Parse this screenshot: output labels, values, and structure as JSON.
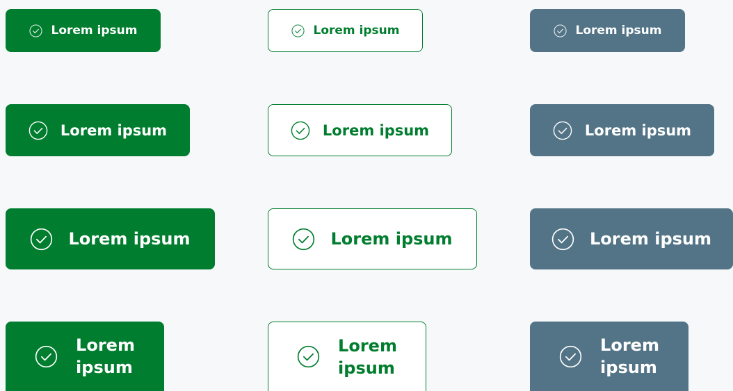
{
  "buttons": {
    "label": "Lorem ipsum",
    "wrapped_line1": "Lorem",
    "wrapped_line2": "ipsum",
    "icon": "check-circle-icon"
  },
  "variants": [
    "primary",
    "outline",
    "secondary"
  ],
  "sizes": [
    "small",
    "medium",
    "large",
    "wrapped"
  ],
  "colors": {
    "primary": "#007d2e",
    "secondary": "#537486",
    "outline_border": "#007d2e",
    "outline_text": "#007d2e",
    "background": "#f6f8fa"
  }
}
